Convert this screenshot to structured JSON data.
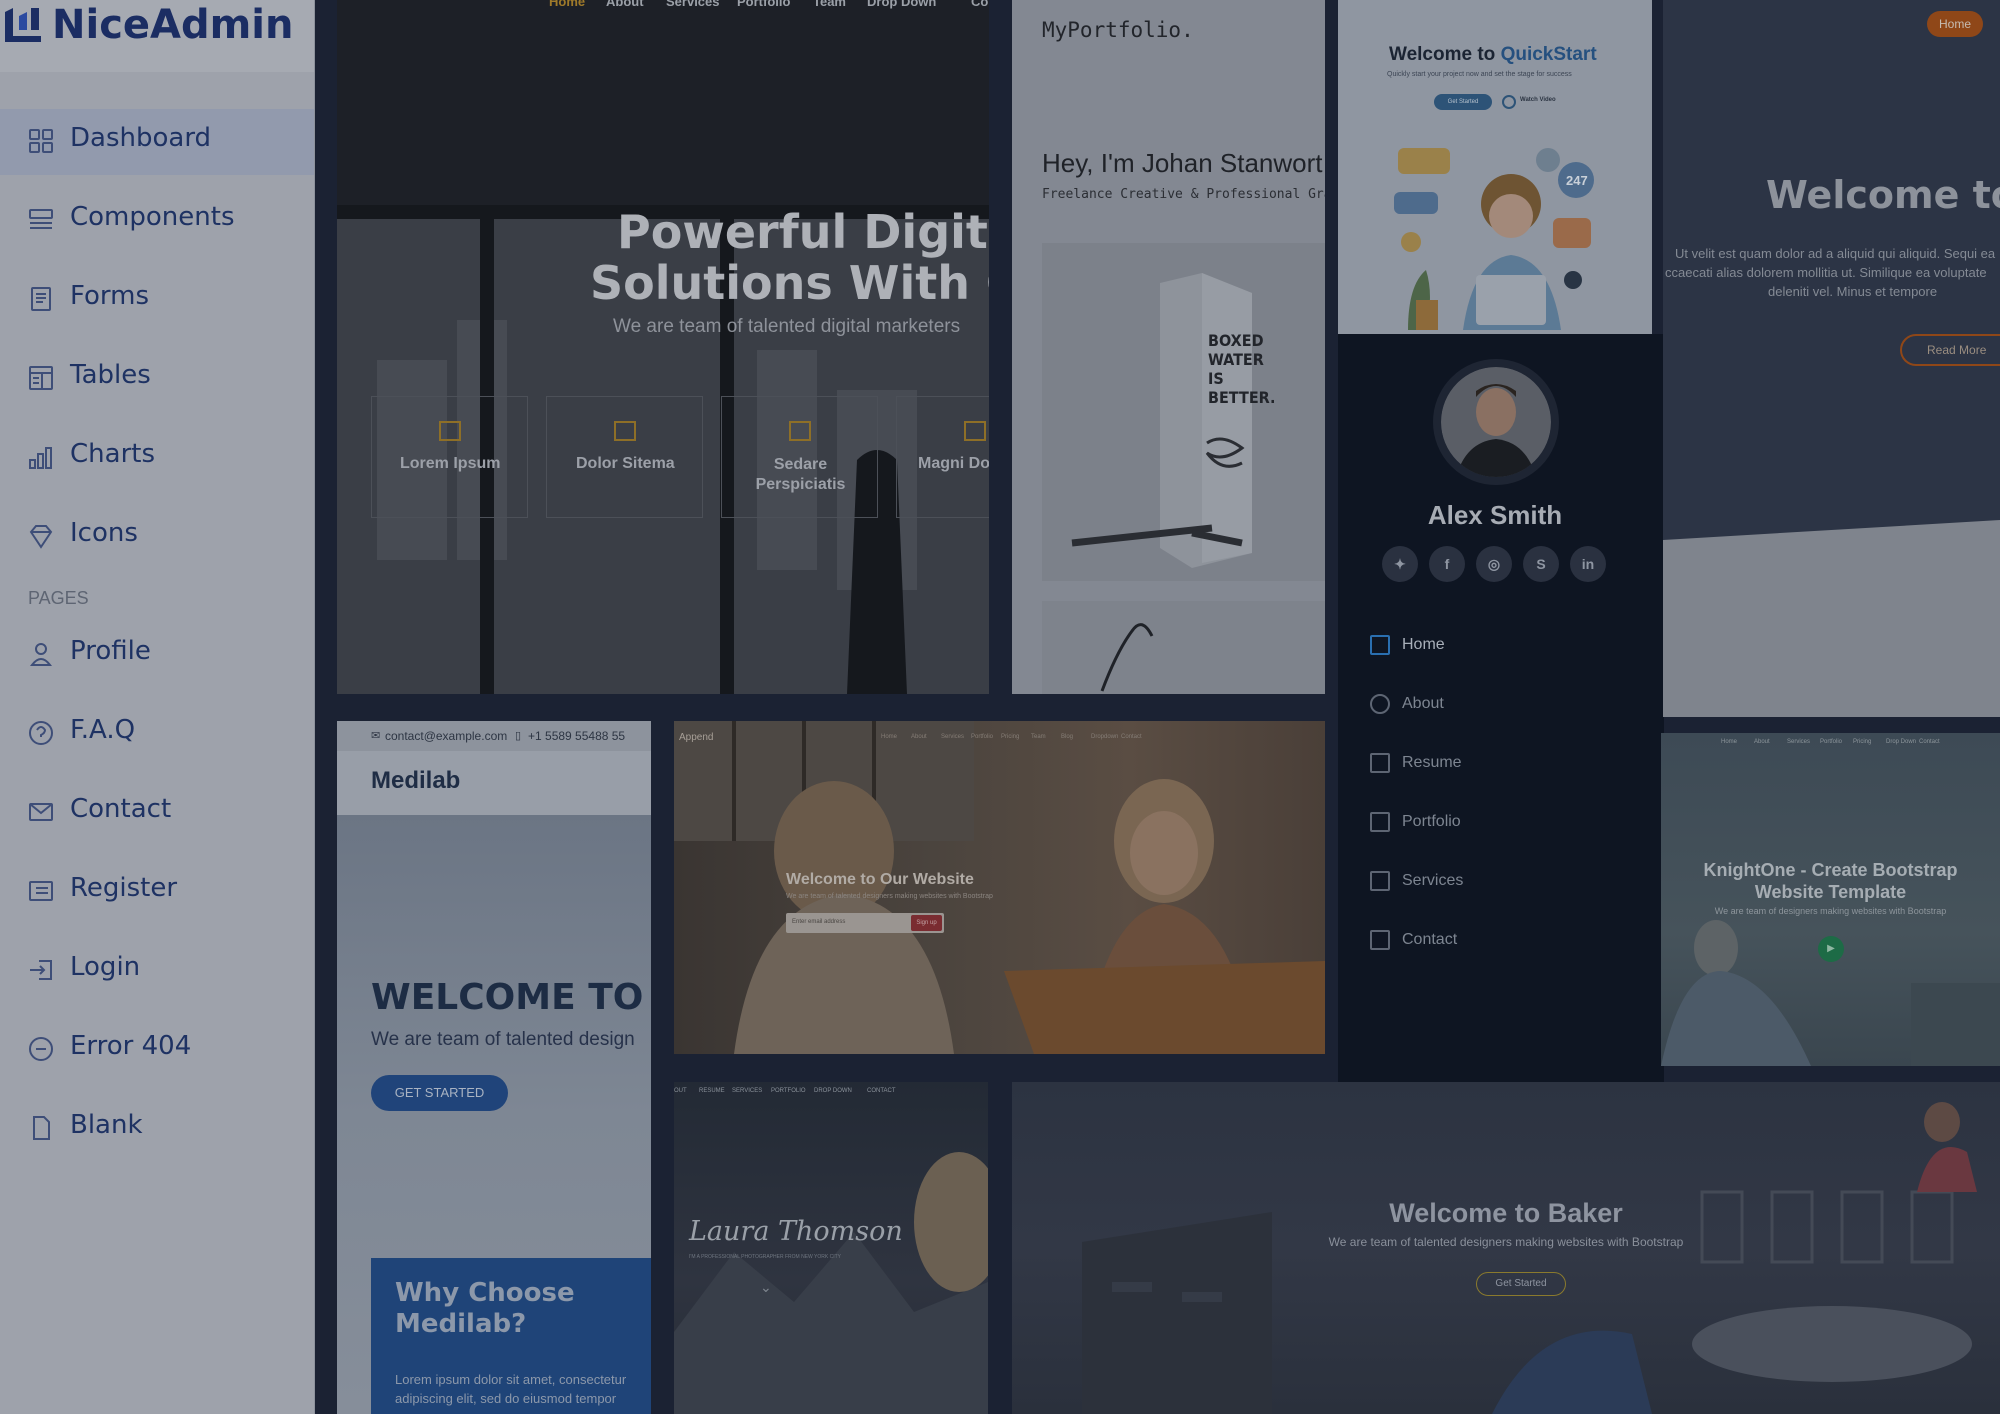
{
  "sidebar": {
    "brand": "NiceAdmin",
    "pages_heading": "PAGES",
    "items": [
      {
        "label": "Dashboard",
        "icon": "grid-icon",
        "active": true
      },
      {
        "label": "Components",
        "icon": "menu-button-icon"
      },
      {
        "label": "Forms",
        "icon": "journal-text-icon"
      },
      {
        "label": "Tables",
        "icon": "layout-text-window-icon"
      },
      {
        "label": "Charts",
        "icon": "bar-chart-icon"
      },
      {
        "label": "Icons",
        "icon": "gem-icon"
      }
    ],
    "page_items": [
      {
        "label": "Profile",
        "icon": "person-icon"
      },
      {
        "label": "F.A.Q",
        "icon": "question-circle-icon"
      },
      {
        "label": "Contact",
        "icon": "envelope-icon"
      },
      {
        "label": "Register",
        "icon": "card-list-icon"
      },
      {
        "label": "Login",
        "icon": "box-arrow-in-right-icon"
      },
      {
        "label": "Error 404",
        "icon": "dash-circle-icon"
      },
      {
        "label": "Blank",
        "icon": "file-icon"
      }
    ]
  },
  "tile1": {
    "nav": [
      "Home",
      "About",
      "Services",
      "Portfolio",
      "Team",
      "Drop Down",
      "Co"
    ],
    "title_line1": "Powerful Digital",
    "title_line2": "Solutions With Gp",
    "subtitle": "We are team of talented digital marketers",
    "boxes": [
      "Lorem Ipsum",
      "Dolor Sitema",
      "Sedare\nPerspiciatis",
      "Magni Do"
    ]
  },
  "tile2": {
    "logo": "MyPortfolio.",
    "heading": "Hey, I'm Johan Stanwort",
    "subheading": "Freelance Creative & Professional Graphi",
    "carton_text": "BOXED WATER IS BETTER."
  },
  "tile3": {
    "title_a": "Welcome to ",
    "title_b": "QuickStart",
    "subtitle": "Quickly start your project now and set the stage for success",
    "btn_primary": "Get Started",
    "btn_video": "Watch Video",
    "badge": "247"
  },
  "tile4": {
    "name": "Alex Smith",
    "social": [
      "twitter-icon",
      "facebook-icon",
      "instagram-icon",
      "skype-icon",
      "linkedin-icon"
    ],
    "nav": [
      {
        "label": "Home",
        "icon": "house-icon",
        "active": true
      },
      {
        "label": "About",
        "icon": "person-icon"
      },
      {
        "label": "Resume",
        "icon": "file-text-icon"
      },
      {
        "label": "Portfolio",
        "icon": "book-icon"
      },
      {
        "label": "Services",
        "icon": "hdd-stack-icon"
      },
      {
        "label": "Contact",
        "icon": "envelope-icon"
      }
    ]
  },
  "tile5": {
    "nav_btn": "Home",
    "title": "Welcome to",
    "text_line1": "Ut velit est quam dolor ad a aliquid qui aliquid. Sequi ea",
    "text_line2": "ccaecati alias dolorem mollitia ut. Similique ea voluptate",
    "text_line3": "deleniti vel. Minus et tempore",
    "button": "Read More"
  },
  "tile6": {
    "email": "contact@example.com",
    "phone": "+1 5589 55488 55",
    "brand": "Medilab",
    "title": "WELCOME TO M",
    "subtitle": "We are team of talented design",
    "button": "GET STARTED",
    "card_title": "Why Choose\nMedilab?",
    "card_text": "Lorem ipsum dolor sit amet, consectetur adipiscing elit, sed do eiusmod tempor"
  },
  "tile7": {
    "brand": "Append",
    "nav": [
      "Home",
      "About",
      "Services",
      "Portfolio",
      "Pricing",
      "Team",
      "Blog",
      "Dropdown",
      "Contact"
    ],
    "title": "Welcome to Our Website",
    "subtitle": "We are team of talented designers making websites with Bootstrap",
    "placeholder": "Enter email address",
    "button": "Sign up"
  },
  "tile8": {
    "nav": [
      "Home",
      "About",
      "Services",
      "Portfolio",
      "Pricing",
      "Drop Down",
      "Contact"
    ],
    "title_line1": "KnightOne - Create Bootstrap",
    "title_line2": "Website Template",
    "subtitle": "We are team of designers making websites with Bootstrap"
  },
  "tile9": {
    "nav": [
      "OUT",
      "RESUME",
      "SERVICES",
      "PORTFOLIO",
      "DROP DOWN",
      "CONTACT"
    ],
    "signature": "Laura Thomson",
    "tagline": "I'M A PROFESSIONAL PHOTOGRAPHER FROM NEW YORK CITY"
  },
  "tile10": {
    "title": "Welcome to Baker",
    "subtitle": "We are team of talented designers making websites with Bootstrap",
    "button": "Get Started"
  }
}
